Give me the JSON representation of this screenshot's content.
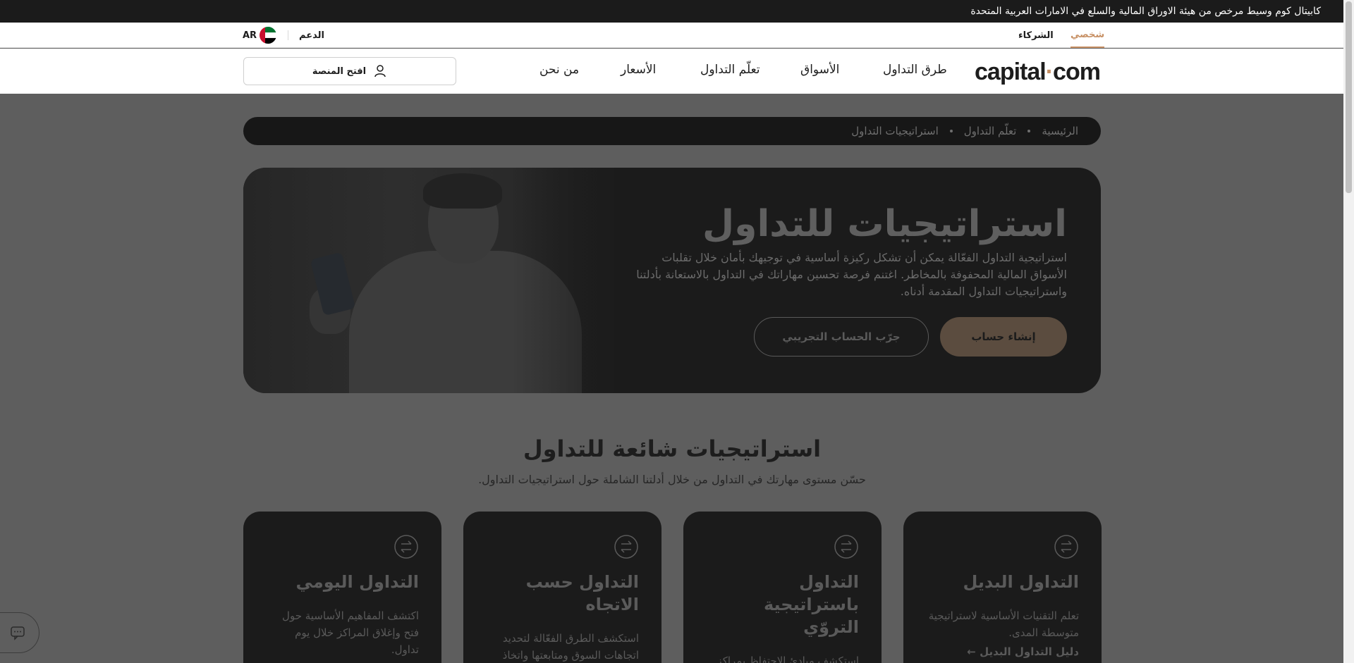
{
  "topbar": {
    "text": "كابيتال كوم وسيط مرخص من هيئة الاوراق المالية والسلع في الامارات العربية المتحدة"
  },
  "subnav": {
    "tab_personal": "شخصي",
    "tab_partners": "الشركاء",
    "support": "الدعم",
    "language": "AR"
  },
  "mainnav": {
    "logo_main": "capital",
    "logo_dot": "·",
    "logo_end": "com",
    "links": [
      "طرق التداول",
      "الأسواق",
      "تعلّم التداول",
      "الأسعار",
      "من نحن"
    ],
    "platform_button": "افتح المنصة"
  },
  "breadcrumb": [
    "الرئيسية",
    "تعلّم التداول",
    "استراتيجيات التداول"
  ],
  "hero": {
    "title": "استراتيجيات للتداول",
    "description": "استراتيجية التداول الفعّالة يمكن أن تشكل ركيزة أساسية في توجيهك بأمان خلال تقلبات الأسواق المالية المحفوفة بالمخاطر. اغتنم فرصة تحسين مهاراتك في التداول بالاستعانة بأدلتنا واستراتيجيات التداول المقدمة أدناه.",
    "primary_button": "إنشاء حساب",
    "secondary_button": "جرّب الحساب التجريبي"
  },
  "section": {
    "title": "استراتيجيات شائعة للتداول",
    "subtitle": "حسّن مستوى مهارتك في التداول من خلال أدلتنا الشاملة حول استراتيجيات التداول."
  },
  "cards": [
    {
      "title": "التداول البديل",
      "text": "تعلم التقنيات الأساسية لاستراتيجية متوسطة المدى.",
      "link": "دليل التداول البديل"
    },
    {
      "title": "التداول باستراتيجية التروّي",
      "text": "استكشف مبادئ الاحتفاظ بمراكز طويلة الأمد.",
      "link": ""
    },
    {
      "title": "التداول حسب الاتجاه",
      "text": "استكشف الطرق الفعّالة لتحديد اتجاهات السوق ومتابعتها واتخاذ الإجراءات المناسبة استنادًا إليها.",
      "link": ""
    },
    {
      "title": "التداول اليومي",
      "text": "اكتشف المفاهيم الأساسية حول فتح وإغلاق المراكز خلال يوم تداول.",
      "link": ""
    }
  ],
  "colors": {
    "accent": "#c79064",
    "dark": "#1b1b1b",
    "overlay": "#5e5e5e"
  }
}
